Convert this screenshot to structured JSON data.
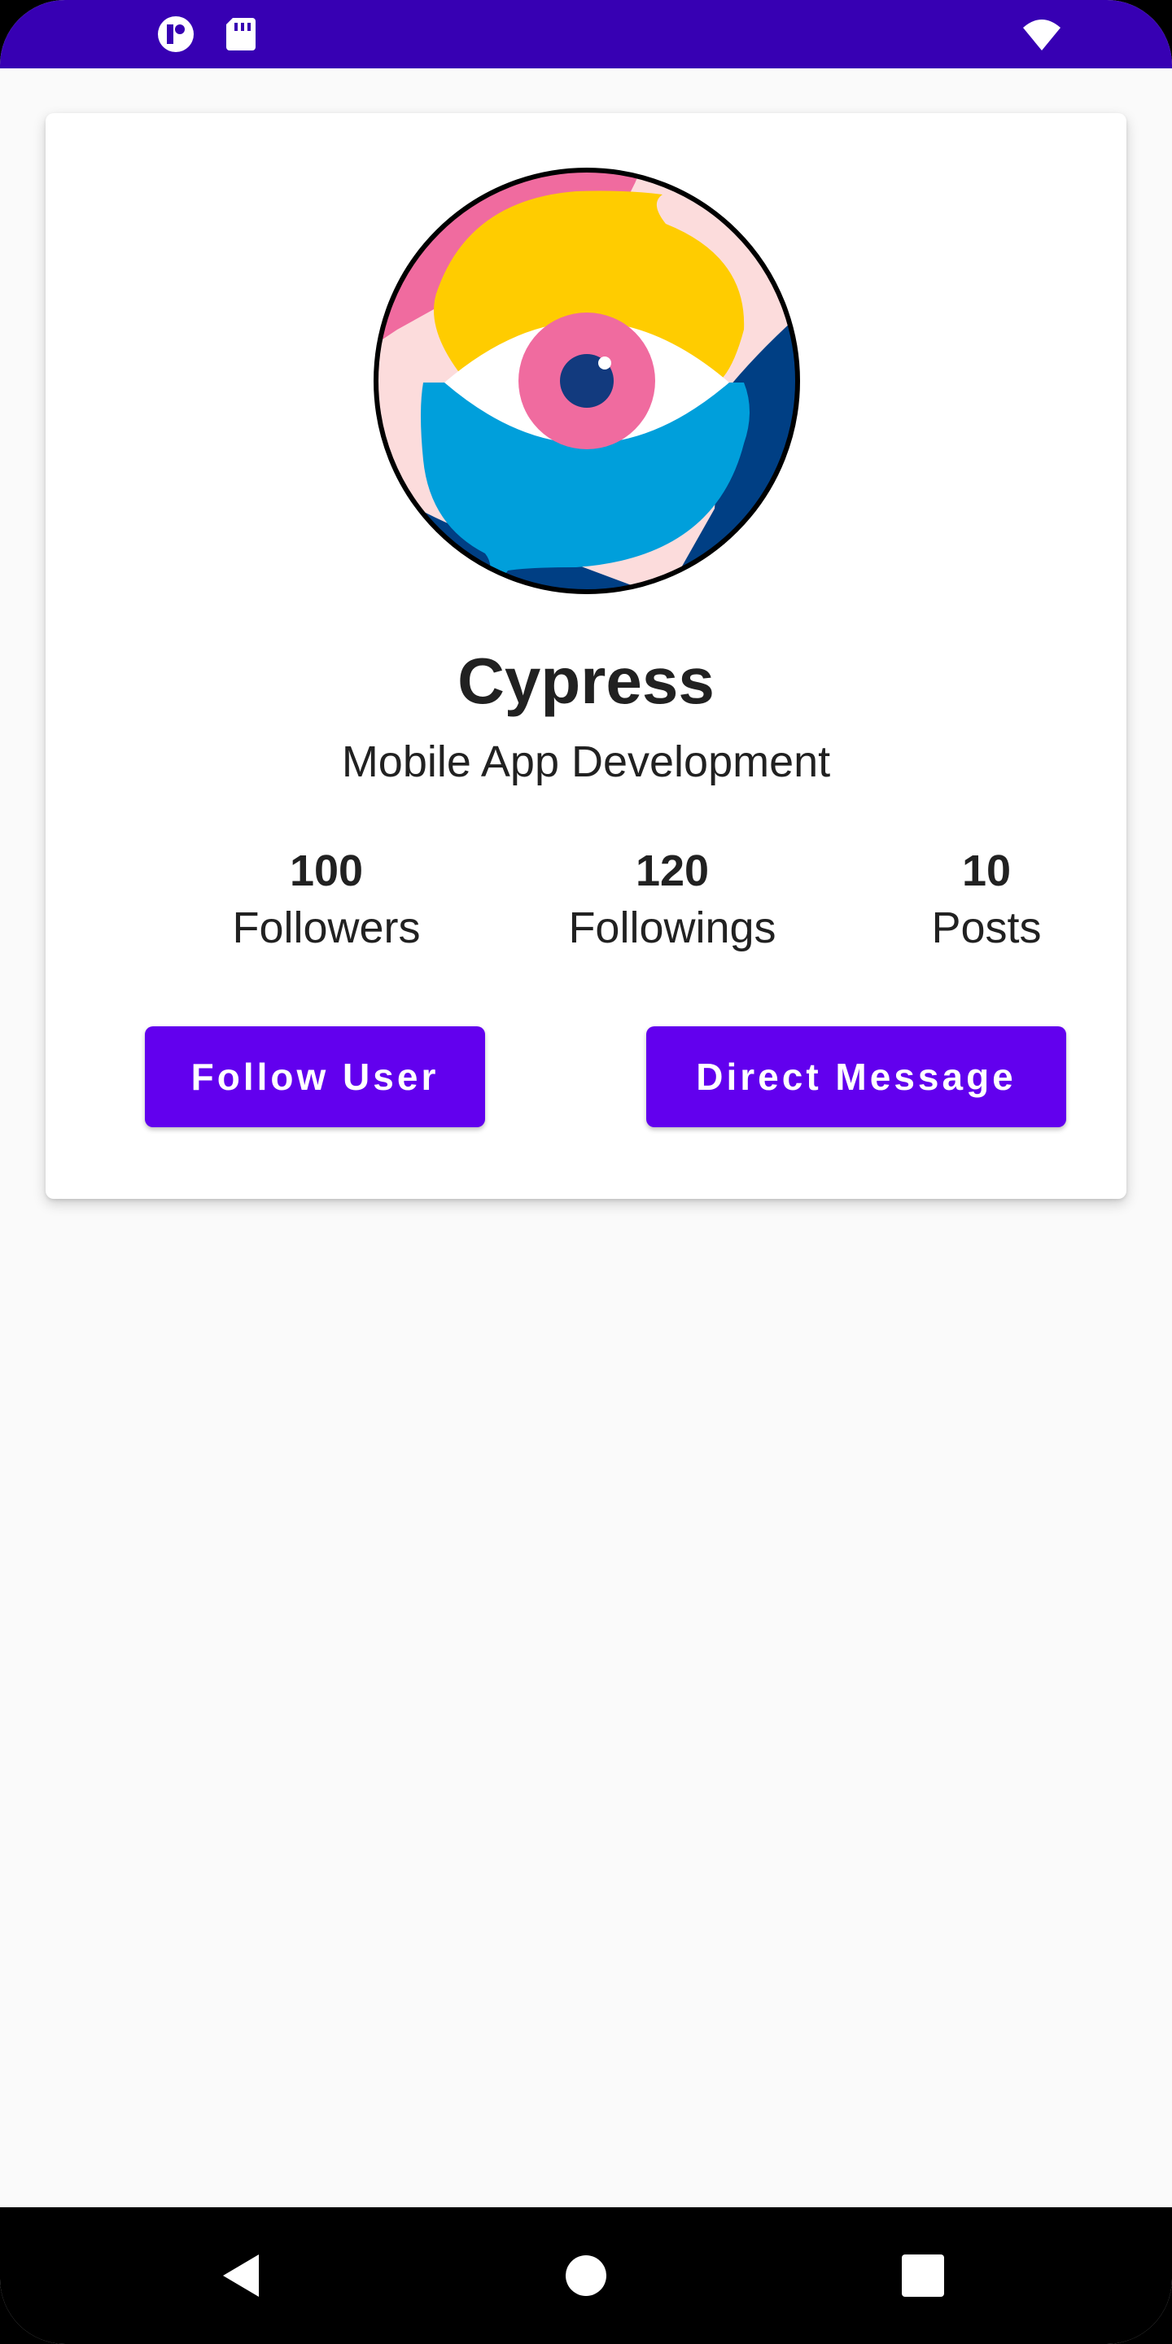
{
  "status_bar": {
    "color": "#3700b3",
    "left_icons": [
      "app-notification-icon",
      "sd-card-icon"
    ],
    "right_icons": [
      "wifi-icon"
    ]
  },
  "profile": {
    "avatar_icon": "eye-speech-bubble-avatar",
    "name": "Cypress",
    "subtitle": "Mobile App Development",
    "stats": [
      {
        "value": "100",
        "label": "Followers"
      },
      {
        "value": "120",
        "label": "Followings"
      },
      {
        "value": "10",
        "label": "Posts"
      }
    ]
  },
  "actions": {
    "follow_label": "Follow User",
    "message_label": "Direct Message",
    "accent": "#6200ee"
  },
  "nav_bar": {
    "icons": [
      "back-icon",
      "home-icon",
      "recents-icon"
    ]
  }
}
